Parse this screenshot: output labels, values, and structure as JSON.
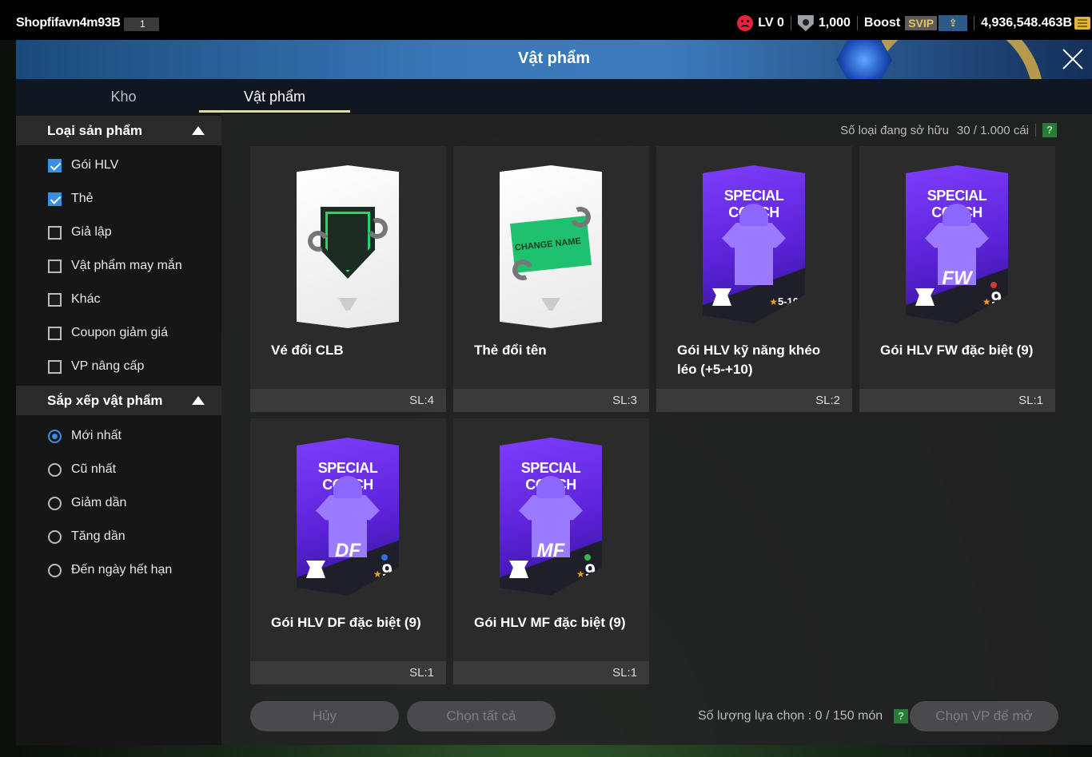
{
  "topbar": {
    "username": "Shopfifavn4m93B",
    "user_badge": "1",
    "level": "LV 0",
    "points": "1,000",
    "boost_label": "Boost",
    "svip_label": "SVIP",
    "coins": "4,936,548.463B",
    "icons": [
      "sad-face-icon",
      "shield-icon",
      "boost-arrow-icon",
      "coin-icon"
    ]
  },
  "header": {
    "title": "Vật phẩm"
  },
  "tabs": [
    {
      "label": "Kho",
      "active": false
    },
    {
      "label": "Vật phẩm",
      "active": true
    }
  ],
  "filters": {
    "product_type": {
      "title": "Loại sản phẩm",
      "options": [
        {
          "label": "Gói HLV",
          "checked": true
        },
        {
          "label": "Thẻ",
          "checked": true
        },
        {
          "label": "Giả lập",
          "checked": false
        },
        {
          "label": "Vật phẩm may mắn",
          "checked": false
        },
        {
          "label": "Khác",
          "checked": false
        },
        {
          "label": "Coupon giảm giá",
          "checked": false
        },
        {
          "label": "VP nâng cấp",
          "checked": false
        }
      ]
    },
    "sort": {
      "title": "Sắp xếp vật phẩm",
      "options": [
        {
          "label": "Mới nhất",
          "selected": true
        },
        {
          "label": "Cũ nhất",
          "selected": false
        },
        {
          "label": "Giảm dần",
          "selected": false
        },
        {
          "label": "Tăng dần",
          "selected": false
        },
        {
          "label": "Đến ngày hết hạn",
          "selected": false
        }
      ]
    }
  },
  "owned": {
    "label": "Số loại đang sở hữu",
    "count": "30 / 1.000 cái",
    "help": "?"
  },
  "items": [
    {
      "name": "Vé đổi CLB",
      "qty": "SL:4",
      "card": "club-ticket"
    },
    {
      "name": "Thẻ đổi tên",
      "qty": "SL:3",
      "card": "change-name",
      "card_text": "CHANGE NAME"
    },
    {
      "name": "Gói HLV kỹ năng khéo léo (+5-+10)",
      "qty": "SL:2",
      "card": "coach",
      "card_title": "SPECIAL COACH",
      "pos": "",
      "rating": "5-10",
      "dot": ""
    },
    {
      "name": "Gói HLV FW đặc biệt (9)",
      "qty": "SL:1",
      "card": "coach",
      "card_title": "SPECIAL COACH",
      "pos": "FW",
      "rating": "9",
      "dot": "#d9383a"
    },
    {
      "name": "Gói HLV DF đặc biệt (9)",
      "qty": "SL:1",
      "card": "coach",
      "card_title": "SPECIAL COACH",
      "pos": "DF",
      "rating": "9",
      "dot": "#2f6fe0"
    },
    {
      "name": "Gói HLV MF đặc biệt (9)",
      "qty": "SL:1",
      "card": "coach",
      "card_title": "SPECIAL COACH",
      "pos": "MF",
      "rating": "9",
      "dot": "#35b84a"
    }
  ],
  "footer": {
    "cancel_label": "Hủy",
    "select_all_label": "Chọn tất cả",
    "selection_text": "Số lượng lựa chọn : 0 / 150 món",
    "help": "?",
    "open_label": "Chọn VP để mở"
  }
}
